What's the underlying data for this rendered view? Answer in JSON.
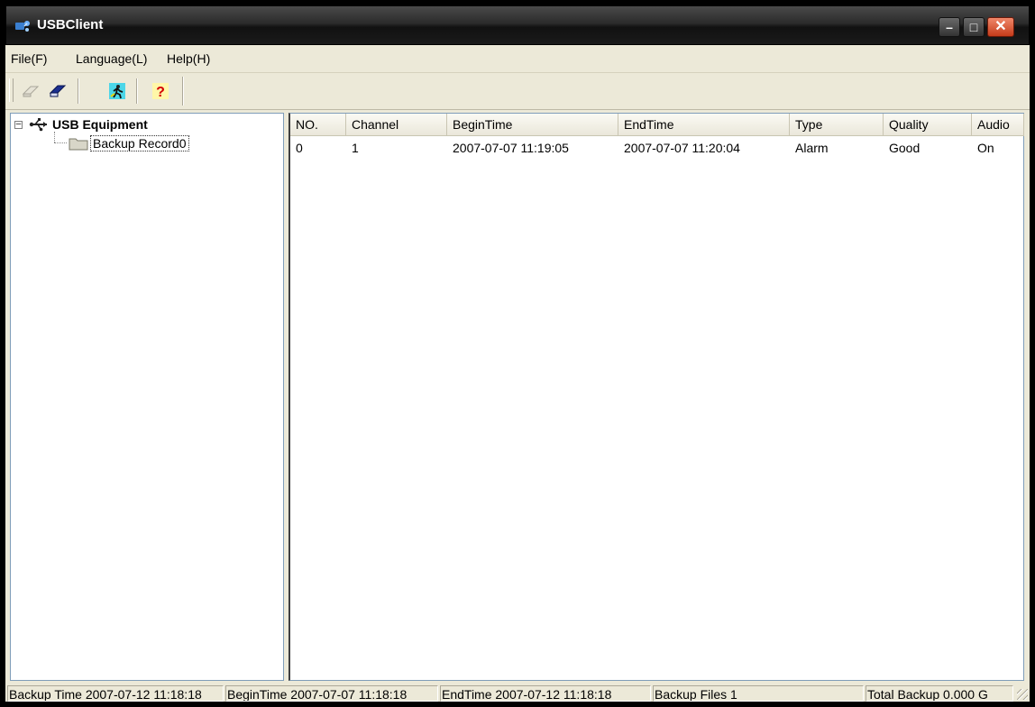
{
  "window": {
    "title": "USBClient"
  },
  "title_buttons": {
    "minimize": "–",
    "maximize": "□",
    "close": "✕"
  },
  "menu": {
    "items": [
      {
        "label": "File(F)"
      },
      {
        "label": "Language(L)"
      },
      {
        "label": "Help(H)"
      }
    ]
  },
  "toolbar": {
    "buttons": [
      {
        "icon": "eraser-icon",
        "enabled": false
      },
      {
        "icon": "eraser-blue-icon",
        "enabled": true
      },
      {
        "icon": "running-man-exit-icon",
        "enabled": true
      },
      {
        "icon": "help-question-icon",
        "enabled": true
      }
    ]
  },
  "tree": {
    "expander": "–",
    "root": {
      "label": "USB Equipment",
      "icon": "usb-icon",
      "expanded": true
    },
    "children": [
      {
        "label": "Backup Record0",
        "icon": "folder-icon",
        "selected": true
      }
    ]
  },
  "table": {
    "columns": [
      "NO.",
      "Channel",
      "BeginTime",
      "EndTime",
      "Type",
      "Quality",
      "Audio"
    ],
    "rows": [
      [
        "0",
        "1",
        "2007-07-07 11:19:05",
        "2007-07-07 11:20:04",
        "Alarm",
        "Good",
        "On"
      ]
    ]
  },
  "status": {
    "backup_time": "Backup Time 2007-07-12 11:18:18",
    "begin_time": "BeginTime 2007-07-07 11:18:18",
    "end_time": "EndTime 2007-07-12 11:18:18",
    "backup_files": "Backup Files 1",
    "total_backup": "Total Backup 0.000 G"
  }
}
